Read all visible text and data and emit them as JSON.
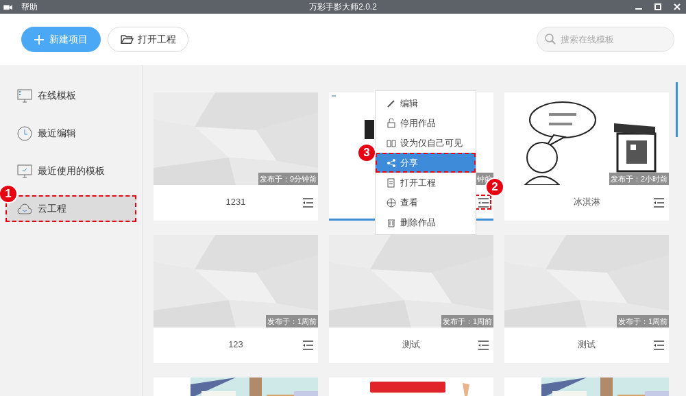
{
  "title_bar": {
    "menu": "帮助",
    "title": "万彩手影大师2.0.2"
  },
  "toolbar": {
    "new_button": "新建项目",
    "open_button": "打开工程",
    "search": {
      "placeholder": "搜索在线模板"
    }
  },
  "sidebar": {
    "items": [
      {
        "label": "在线模板",
        "selected": false
      },
      {
        "label": "最近编辑",
        "selected": false
      },
      {
        "label": "最近使用的模板",
        "selected": false
      },
      {
        "label": "云工程",
        "selected": true,
        "marker": "1"
      }
    ]
  },
  "cards": [
    {
      "kind": "paper",
      "name": "1231",
      "badge": "发布于：9分钟前",
      "selected": false
    },
    {
      "kind": "white",
      "badge": "钟前",
      "selected": true,
      "marker": "2"
    },
    {
      "kind": "cartoon",
      "name": "冰淇淋",
      "badge": "发布于：2小时前",
      "selected": false
    },
    {
      "kind": "paper",
      "name": "123",
      "badge": "发布于：1周前",
      "selected": false
    },
    {
      "kind": "paper",
      "name": "测试",
      "badge": "发布于：1周前",
      "selected": false
    },
    {
      "kind": "paper",
      "name": "测试",
      "badge": "发布于：1周前",
      "selected": false
    },
    {
      "kind": "shop"
    },
    {
      "kind": "red-title"
    },
    {
      "kind": "shop"
    }
  ],
  "context_menu": {
    "items": [
      {
        "label": "编辑",
        "selected": false
      },
      {
        "label": "停用作品",
        "selected": false
      },
      {
        "label": "设为仅自己可见",
        "selected": false
      },
      {
        "label": "分享",
        "selected": true,
        "marker": "3"
      },
      {
        "label": "打开工程",
        "selected": false
      },
      {
        "label": "查看",
        "selected": false
      },
      {
        "label": "删除作品",
        "selected": false
      }
    ]
  }
}
